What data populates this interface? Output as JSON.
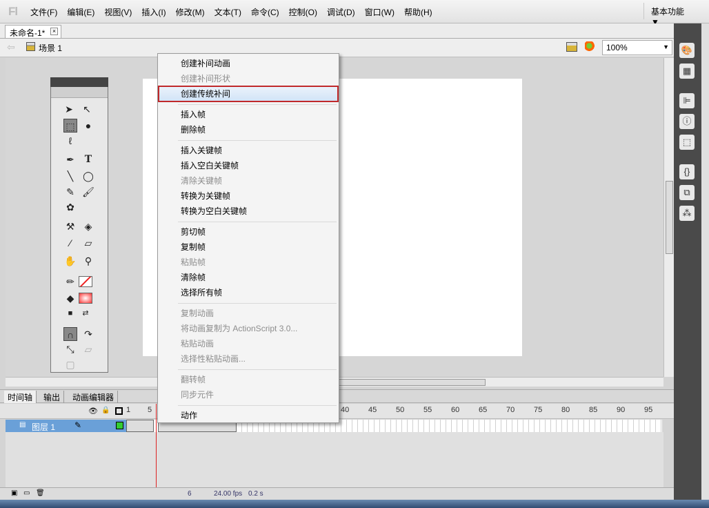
{
  "app": {
    "logo": "Fl",
    "workspace": "基本功能 ▼"
  },
  "menubar": [
    "文件(F)",
    "编辑(E)",
    "视图(V)",
    "插入(I)",
    "修改(M)",
    "文本(T)",
    "命令(C)",
    "控制(O)",
    "调试(D)",
    "窗口(W)",
    "帮助(H)"
  ],
  "document": {
    "tab": "未命名-1*",
    "close": "×"
  },
  "scene": {
    "label": "场景 1",
    "zoom": "100%"
  },
  "context_menu": {
    "items": [
      {
        "label": "创建补间动画",
        "enabled": true
      },
      {
        "label": "创建补间形状",
        "enabled": false
      },
      {
        "label": "创建传统补间",
        "enabled": true,
        "highlighted": true
      },
      {
        "label": "插入帧",
        "enabled": true
      },
      {
        "label": "删除帧",
        "enabled": true
      },
      {
        "label": "插入关键帧",
        "enabled": true
      },
      {
        "label": "插入空白关键帧",
        "enabled": true
      },
      {
        "label": "清除关键帧",
        "enabled": false
      },
      {
        "label": "转换为关键帧",
        "enabled": true
      },
      {
        "label": "转换为空白关键帧",
        "enabled": true
      },
      {
        "label": "剪切帧",
        "enabled": true
      },
      {
        "label": "复制帧",
        "enabled": true
      },
      {
        "label": "粘贴帧",
        "enabled": false
      },
      {
        "label": "清除帧",
        "enabled": true
      },
      {
        "label": "选择所有帧",
        "enabled": true
      },
      {
        "label": "复制动画",
        "enabled": false
      },
      {
        "label": "将动画复制为 ActionScript 3.0...",
        "enabled": false
      },
      {
        "label": "粘贴动画",
        "enabled": false
      },
      {
        "label": "选择性粘贴动画...",
        "enabled": false
      },
      {
        "label": "翻转帧",
        "enabled": false
      },
      {
        "label": "同步元件",
        "enabled": false
      },
      {
        "label": "动作",
        "enabled": true
      }
    ]
  },
  "timeline": {
    "tabs": [
      "时间轴",
      "输出",
      "动画编辑器"
    ],
    "ruler": [
      "1",
      "5",
      "40",
      "45",
      "50",
      "55",
      "60",
      "65",
      "70",
      "75",
      "80",
      "85",
      "90",
      "95"
    ],
    "layer": "图层 1",
    "current_frame": "6",
    "fps": "24.00 fps",
    "time": "0.2 s"
  }
}
